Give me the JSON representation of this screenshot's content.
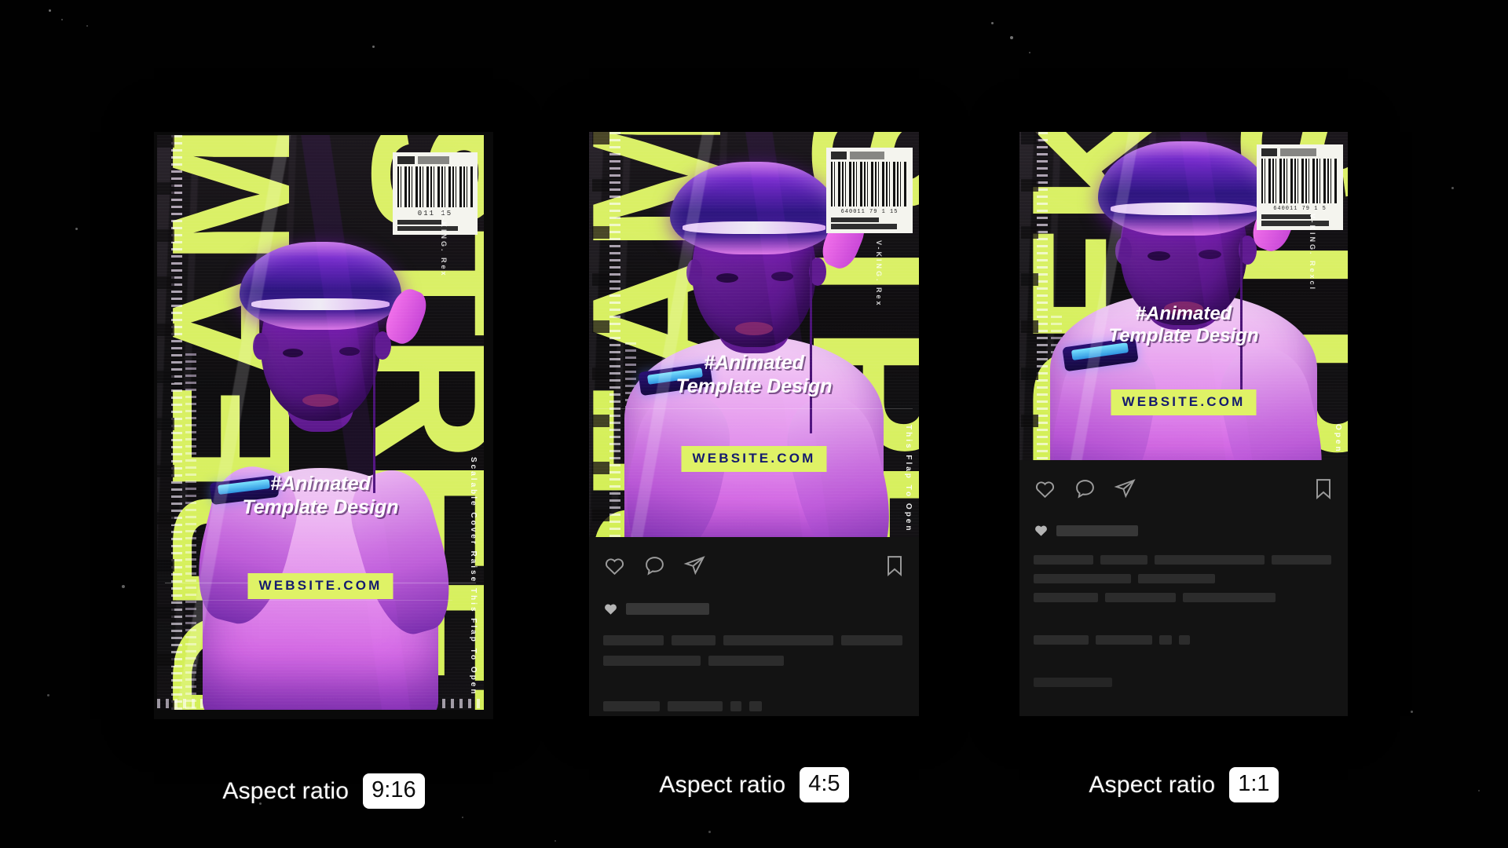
{
  "background": {
    "color": "#010101"
  },
  "theme": {
    "lime": "#dff266",
    "badge_text_color": "#141a6e",
    "poster_purple": "#b83fd0",
    "chip_bg": "#ffffff",
    "chip_text": "#0c0c0c",
    "footer_bg": "#131313",
    "placeholder_bar": "#2c2c2c"
  },
  "cards": [
    {
      "id": "card-9-16",
      "ratio_label": "Aspect ratio",
      "ratio_value": "9:16",
      "poster": {
        "headline_line1": "#Animated",
        "headline_line2": "Template Design",
        "website_badge": "WEBSITE.COM",
        "lime_type_left": "DREAM",
        "lime_type_right": "STREET",
        "barcode_number": "011        15",
        "vertical_copy_right": "Scalable Cover Raise This Flap To Open",
        "vertical_copy_inner": "V-KING. Rex"
      },
      "has_social_footer": false,
      "social": null
    },
    {
      "id": "card-4-5",
      "ratio_label": "Aspect ratio",
      "ratio_value": "4:5",
      "poster": {
        "headline_line1": "#Animated",
        "headline_line2": "Template Design",
        "website_badge": "WEBSITE.COM",
        "lime_type_left": "DREAM",
        "lime_type_right": "STREET",
        "barcode_number": "640011 79 1 15",
        "vertical_copy_right": "This Flap To Open",
        "vertical_copy_inner": "V-KING. Rex"
      },
      "has_social_footer": true,
      "social": {
        "like_icon": "heart-icon",
        "comment_icon": "comment-icon",
        "share_icon": "share-icon",
        "save_icon": "bookmark-icon",
        "likes_heart_icon": "heart-solid-icon",
        "placeholder_rows": [
          [
            190
          ],
          [
            184,
            110,
            265,
            125
          ],
          [
            224,
            118
          ],
          [],
          [
            133,
            131,
            24,
            27
          ]
        ]
      }
    },
    {
      "id": "card-1-1",
      "ratio_label": "Aspect ratio",
      "ratio_value": "1:1",
      "poster": {
        "headline_line1": "#Animated",
        "headline_line2": "Template Design",
        "website_badge": "WEBSITE.COM",
        "lime_type_left": "TREK",
        "lime_type_right": "STREET",
        "barcode_number": "640011 79 1 5",
        "vertical_copy_right": "Open",
        "vertical_copy_inner": "V-KING. Rexcl"
      },
      "has_social_footer": true,
      "social": {
        "like_icon": "heart-icon",
        "comment_icon": "comment-icon",
        "share_icon": "share-icon",
        "save_icon": "bookmark-icon",
        "likes_heart_icon": "heart-solid-icon",
        "placeholder_rows": [
          [
            104
          ],
          [
            76,
            60,
            140,
            76
          ],
          [
            124,
            98
          ],
          [
            82,
            90,
            118
          ],
          [
            70,
            72,
            18,
            16
          ],
          [
            102
          ]
        ]
      }
    }
  ]
}
